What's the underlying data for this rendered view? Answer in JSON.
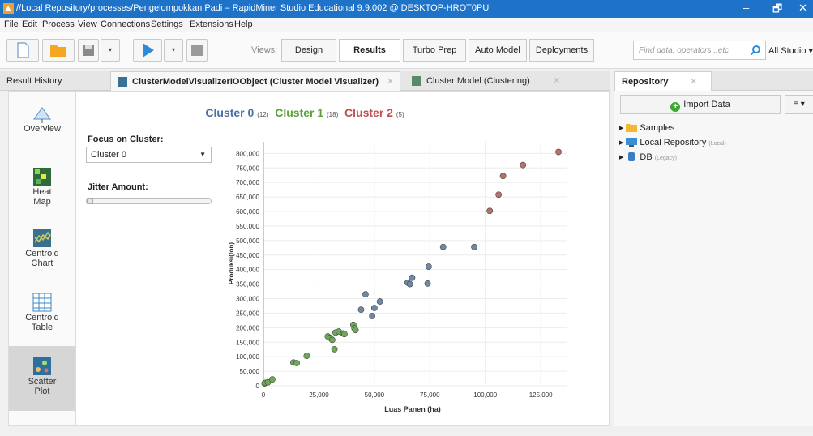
{
  "window": {
    "title": "//Local Repository/processes/Pengelompokkan Padi – RapidMiner Studio Educational 9.9.002 @ DESKTOP-HROT0PU",
    "controls": [
      "–",
      "🗗",
      "✕"
    ]
  },
  "menu": [
    "File",
    "Edit",
    "Process",
    "View",
    "Connections",
    "Settings",
    "Extensions",
    "Help"
  ],
  "toolbar": {
    "views_label": "Views:",
    "views": [
      "Design",
      "Results",
      "Turbo Prep",
      "Auto Model",
      "Deployments"
    ],
    "active_view": "Results",
    "search_placeholder": "Find data, operators...etc",
    "studio_label": "All Studio ▾",
    "dropdown_glyph": "▾"
  },
  "tabs": {
    "result_history": "Result History",
    "visualizer": "ClusterModelVisualizerIOObject (Cluster Model Visualizer)",
    "clustering": "Cluster Model (Clustering)",
    "close_glyph": "✕"
  },
  "nav": [
    {
      "label": "Overview",
      "icon": "overview-icon"
    },
    {
      "label": "Heat Map",
      "icon": "heat-map-icon"
    },
    {
      "label": "Centroid Chart",
      "icon": "centroid-chart-icon"
    },
    {
      "label": "Centroid Table",
      "icon": "centroid-table-icon"
    },
    {
      "label": "Scatter Plot",
      "icon": "scatter-plot-icon",
      "active": true
    }
  ],
  "controls": {
    "focus_label": "Focus on Cluster:",
    "focus_value": "Cluster 0",
    "jitter_label": "Jitter Amount:",
    "jitter_value": 0
  },
  "legend": [
    {
      "name": "Cluster 0",
      "count": "(12)",
      "color": "#4a6fa5"
    },
    {
      "name": "Cluster 1",
      "count": "(18)",
      "color": "#5ba33b"
    },
    {
      "name": "Cluster 2",
      "count": "(5)",
      "color": "#c0504d"
    }
  ],
  "chart_data": {
    "type": "scatter",
    "xlabel": "Luas Panen (ha)",
    "ylabel": "Produksi(ton)",
    "xlim": [
      0,
      137000
    ],
    "ylim": [
      0,
      840000
    ],
    "xticks": [
      0,
      25000,
      50000,
      75000,
      100000,
      125000
    ],
    "xtick_labels": [
      "0",
      "25,000",
      "50,000",
      "75,000",
      "100,000",
      "125,000"
    ],
    "yticks": [
      0,
      50000,
      100000,
      150000,
      200000,
      250000,
      300000,
      350000,
      400000,
      450000,
      500000,
      550000,
      600000,
      650000,
      700000,
      750000,
      800000
    ],
    "ytick_labels": [
      "0",
      "50,000",
      "100,000",
      "150,000",
      "200,000",
      "250,000",
      "300,000",
      "350,000",
      "400,000",
      "450,000",
      "500,000",
      "550,000",
      "600,000",
      "650,000",
      "700,000",
      "750,000",
      "800,000"
    ],
    "grid": true,
    "series": [
      {
        "name": "Cluster 0",
        "color": "#6f88a8",
        "points": [
          [
            44000,
            262000
          ],
          [
            46000,
            315000
          ],
          [
            49000,
            240000
          ],
          [
            50000,
            268000
          ],
          [
            52500,
            290000
          ],
          [
            65000,
            355000
          ],
          [
            66000,
            350000
          ],
          [
            67000,
            372000
          ],
          [
            74000,
            352000
          ],
          [
            74500,
            410000
          ],
          [
            81000,
            478000
          ],
          [
            95000,
            478000
          ]
        ]
      },
      {
        "name": "Cluster 1",
        "color": "#6ea95a",
        "points": [
          [
            500,
            8000
          ],
          [
            1000,
            10000
          ],
          [
            2000,
            12000
          ],
          [
            4000,
            22000
          ],
          [
            13500,
            80000
          ],
          [
            15000,
            78000
          ],
          [
            19500,
            103000
          ],
          [
            29000,
            170000
          ],
          [
            30000,
            165000
          ],
          [
            31000,
            158000
          ],
          [
            32000,
            126000
          ],
          [
            32500,
            183000
          ],
          [
            34000,
            187000
          ],
          [
            36000,
            180000
          ],
          [
            36500,
            178000
          ],
          [
            40500,
            210000
          ],
          [
            41000,
            198000
          ],
          [
            41500,
            192000
          ]
        ]
      },
      {
        "name": "Cluster 2",
        "color": "#b87068",
        "points": [
          [
            102000,
            602000
          ],
          [
            106000,
            658000
          ],
          [
            108000,
            722000
          ],
          [
            117000,
            760000
          ],
          [
            133000,
            805000
          ]
        ]
      }
    ]
  },
  "repository": {
    "tab_label": "Repository",
    "import_label": "Import Data",
    "menu_label": "≡ ▾",
    "items": [
      {
        "label": "Samples",
        "sub": ""
      },
      {
        "label": "Local Repository",
        "sub": "(Local)"
      },
      {
        "label": "DB",
        "sub": "(Legacy)"
      }
    ]
  },
  "colors": {
    "titlebar": "#1e73c9",
    "cluster0": "#4a6fa5",
    "cluster1": "#5ba33b",
    "cluster2": "#c0504d"
  }
}
